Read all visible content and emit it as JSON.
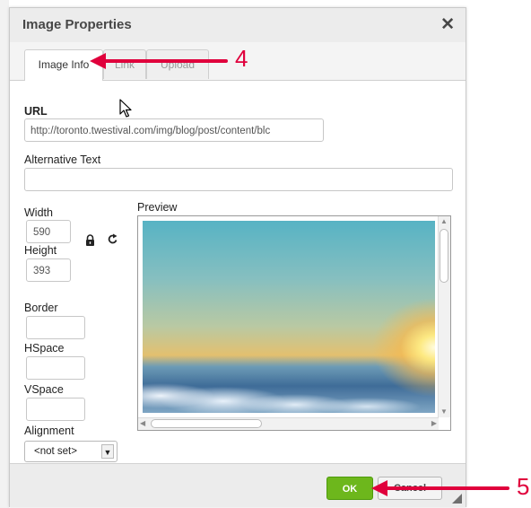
{
  "dialog": {
    "title": "Image Properties",
    "close_glyph": "✕",
    "tabs": [
      {
        "label": "Image Info",
        "active": true
      },
      {
        "label": "Link",
        "active": false
      },
      {
        "label": "Upload",
        "active": false
      }
    ]
  },
  "form": {
    "url_label": "URL",
    "url_value": "http://toronto.twestival.com/img/blog/post/content/blc",
    "alt_label": "Alternative Text",
    "alt_value": "",
    "width_label": "Width",
    "width_value": "590",
    "height_label": "Height",
    "height_value": "393",
    "border_label": "Border",
    "border_value": "",
    "hspace_label": "HSpace",
    "hspace_value": "",
    "vspace_label": "VSpace",
    "vspace_value": "",
    "alignment_label": "Alignment",
    "alignment_value": "<not set>",
    "lock_icon": "lock-icon",
    "reset_icon": "reset-size-icon"
  },
  "preview": {
    "label": "Preview",
    "image_subject": "sunset-over-clouds"
  },
  "footer": {
    "ok_label": "OK",
    "cancel_label": "Cancel"
  },
  "annotations": {
    "step_tab": "4",
    "step_ok": "5",
    "color": "#e0003c"
  },
  "colors": {
    "ok_green": "#6db71c",
    "titlebar": "#ececec"
  }
}
